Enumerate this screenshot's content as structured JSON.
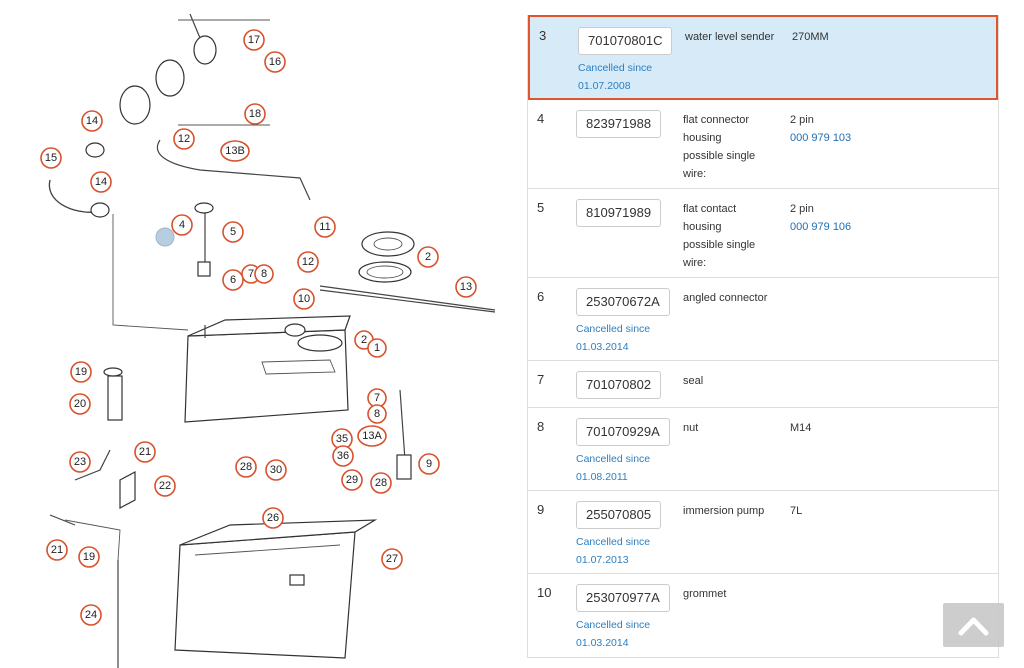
{
  "diagram": {
    "callouts": [
      "17",
      "16",
      "18",
      "14",
      "12",
      "15",
      "13B",
      "14",
      "4",
      "5",
      "11",
      "2",
      "12",
      "7",
      "8",
      "6",
      "13",
      "10",
      "2",
      "1",
      "19",
      "7",
      "20",
      "8",
      "35",
      "13A",
      "9",
      "21",
      "36",
      "23",
      "28",
      "30",
      "29",
      "28",
      "22",
      "26",
      "27",
      "21",
      "19",
      "24"
    ]
  },
  "parts": [
    {
      "pos": "3",
      "part_no": "701070801C",
      "cancel_label": "Cancelled since",
      "cancel_date": "01.07.2008",
      "desc_lines": [
        "water level sender"
      ],
      "note": "270MM",
      "link": ""
    },
    {
      "pos": "4",
      "part_no": "823971988",
      "cancel_label": "",
      "cancel_date": "",
      "desc_lines": [
        "flat connector",
        "housing",
        "possible single",
        "wire:"
      ],
      "note": "2 pin",
      "link": "000 979 103"
    },
    {
      "pos": "5",
      "part_no": "810971989",
      "cancel_label": "",
      "cancel_date": "",
      "desc_lines": [
        "flat contact",
        "housing",
        "possible single",
        "wire:"
      ],
      "note": "2 pin",
      "link": "000 979 106"
    },
    {
      "pos": "6",
      "part_no": "253070672A",
      "cancel_label": "Cancelled since",
      "cancel_date": "01.03.2014",
      "desc_lines": [
        "angled connector"
      ],
      "note": "",
      "link": ""
    },
    {
      "pos": "7",
      "part_no": "701070802",
      "cancel_label": "",
      "cancel_date": "",
      "desc_lines": [
        "seal"
      ],
      "note": "",
      "link": ""
    },
    {
      "pos": "8",
      "part_no": "701070929A",
      "cancel_label": "Cancelled since",
      "cancel_date": "01.08.2011",
      "desc_lines": [
        "nut"
      ],
      "note": "M14",
      "link": ""
    },
    {
      "pos": "9",
      "part_no": "255070805",
      "cancel_label": "Cancelled since",
      "cancel_date": "01.07.2013",
      "desc_lines": [
        "immersion pump"
      ],
      "note": "7L",
      "link": ""
    },
    {
      "pos": "10",
      "part_no": "253070977A",
      "cancel_label": "Cancelled since",
      "cancel_date": "01.03.2014",
      "desc_lines": [
        "grommet"
      ],
      "note": "",
      "link": ""
    }
  ],
  "scroll_top": {
    "icon": "chevron-up-icon"
  },
  "colors": {
    "accent": "#e0562a",
    "selected_bg": "#d6ebf7",
    "link": "#1f6fb2"
  }
}
